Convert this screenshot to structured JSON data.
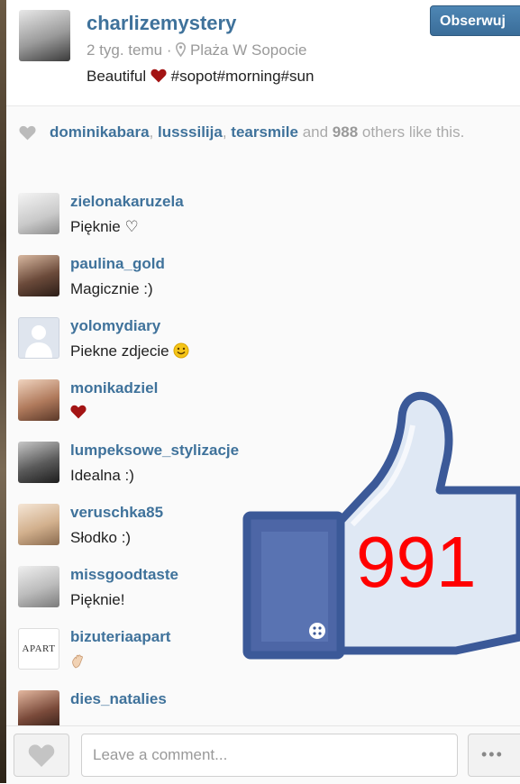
{
  "post": {
    "username": "charlizemystery",
    "time": "2 tyg. temu",
    "location": "Plaża W Sopocie",
    "caption_before": "Beautiful",
    "caption_after": "#sopot#morning#sun",
    "follow_label": "Obserwuj"
  },
  "likes": {
    "users": [
      "dominikabara",
      "lusssilija",
      "tearsmile"
    ],
    "and_text": "and",
    "count": "988",
    "others_text": "others like this."
  },
  "comments": [
    {
      "user": "zielonakaruzela",
      "text": "Pięknie ♡",
      "avatar_color": "#d9d9d9"
    },
    {
      "user": "paulina_gold",
      "text": "Magicznie :)",
      "avatar_color": "#6b4a3a"
    },
    {
      "user": "yolomydiary",
      "text": "Piekne zdjecie",
      "avatar_color": "#dfe5ee",
      "emoji": "smile"
    },
    {
      "user": "monikadziel",
      "text": "",
      "avatar_color": "#8a5a44",
      "emoji": "heart"
    },
    {
      "user": "lumpeksowe_stylizacje",
      "text": "Idealna :)",
      "avatar_color": "#5a4a42"
    },
    {
      "user": "veruschka85",
      "text": "Słodko :)",
      "avatar_color": "#c8a98a"
    },
    {
      "user": "missgoodtaste",
      "text": "Pięknie!",
      "avatar_color": "#bdbdbd"
    },
    {
      "user": "bizuteriaapart",
      "text": "",
      "avatar_text": "APART",
      "avatar_color": "#ffffff",
      "emoji": "hand"
    },
    {
      "user": "dies_natalies",
      "text": "",
      "avatar_color": "#7a4a3a"
    }
  ],
  "footer": {
    "comment_placeholder": "Leave a comment...",
    "more_label": "•••"
  },
  "overlay": {
    "like_count": "991",
    "icon": "thumbs-up-icon"
  },
  "colors": {
    "link": "#3f729b",
    "like_count": "#ff0000",
    "thumb_fill": "#dfe8f4",
    "thumb_outline": "#3b5998"
  }
}
